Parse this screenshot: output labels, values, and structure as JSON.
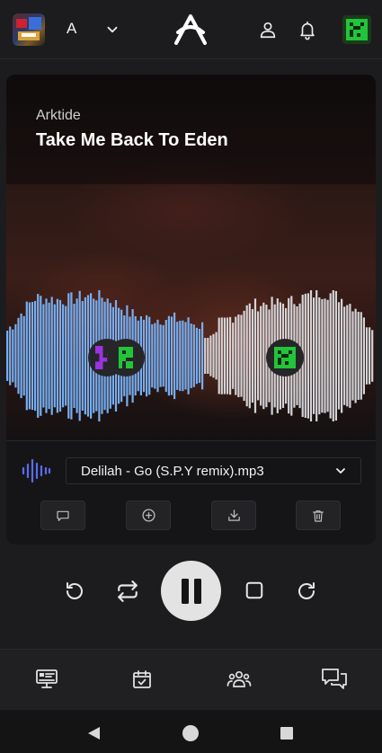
{
  "topbar": {
    "workspace_letter": "A",
    "icons": [
      "album-thumbnail",
      "chevron-down-icon",
      "logo",
      "user-icon",
      "bell-icon",
      "avatar"
    ]
  },
  "track": {
    "artist": "Arktide",
    "title": "Take Me Back To Eden",
    "progress": 0.53
  },
  "file_select": {
    "value": "Delilah - Go (S.P.Y remix).mp3"
  },
  "actions": [
    "comment-icon",
    "add-icon",
    "download-icon",
    "trash-icon"
  ],
  "transport": [
    "rewind-icon",
    "repeat-icon",
    "pause-icon",
    "stop-icon",
    "forward-icon"
  ],
  "bottom_nav": [
    "dashboard-icon",
    "calendar-icon",
    "team-icon",
    "chat-icon"
  ],
  "colors": {
    "played": "#79aef0",
    "unplayed": "#d4d4d8",
    "marker_purple": "#9b33e0",
    "marker_green": "#22c53a",
    "accent_blue": "#5a6cf0"
  }
}
